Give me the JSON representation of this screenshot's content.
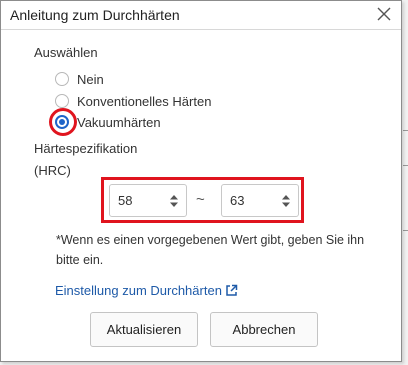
{
  "dialog": {
    "title": "Anleitung zum Durchhärten",
    "close_icon": "close-icon"
  },
  "selection": {
    "label": "Auswählen",
    "options": [
      {
        "label": "Nein",
        "checked": false
      },
      {
        "label": "Konventionelles Härten",
        "checked": false
      },
      {
        "label": "Vakuumhärten",
        "checked": true
      }
    ]
  },
  "hardness": {
    "label_line1": "Härtespezifikation",
    "label_line2": "(HRC)",
    "min_value": "58",
    "separator": "~",
    "max_value": "63"
  },
  "note": {
    "text": "*Wenn es einen vorgegebenen Wert gibt, geben Sie ihn bitte ein."
  },
  "link": {
    "text": "Einstellung zum Durchhärten",
    "icon": "external-link-icon"
  },
  "buttons": {
    "update_label": "Aktualisieren",
    "cancel_label": "Abbrechen"
  },
  "colors": {
    "accent": "#1e64c8",
    "highlight": "#e0141e",
    "link": "#1e5aa8"
  }
}
